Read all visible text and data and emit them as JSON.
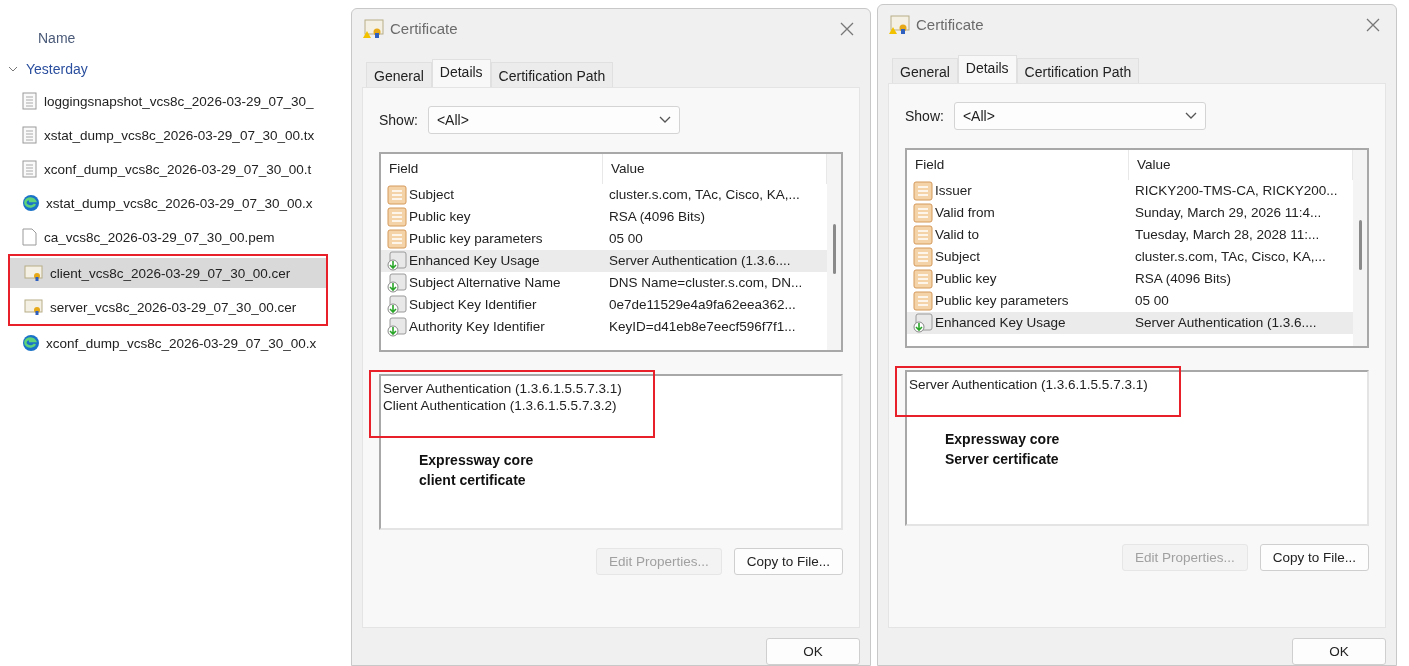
{
  "explorer": {
    "column_header": "Name",
    "group": {
      "label": "Yesterday",
      "expanded": true
    },
    "files": [
      {
        "name": "loggingsnapshot_vcs8c_2026-03-29_07_30_",
        "kind": "text",
        "selected": false,
        "highlighted": false
      },
      {
        "name": "xstat_dump_vcs8c_2026-03-29_07_30_00.tx",
        "kind": "text",
        "selected": false,
        "highlighted": false
      },
      {
        "name": "xconf_dump_vcs8c_2026-03-29_07_30_00.t",
        "kind": "text",
        "selected": false,
        "highlighted": false
      },
      {
        "name": "xstat_dump_vcs8c_2026-03-29_07_30_00.x",
        "kind": "web",
        "selected": false,
        "highlighted": false
      },
      {
        "name": "ca_vcs8c_2026-03-29_07_30_00.pem",
        "kind": "blank",
        "selected": false,
        "highlighted": false
      },
      {
        "name": "client_vcs8c_2026-03-29_07_30_00.cer",
        "kind": "cert",
        "selected": true,
        "highlighted": true
      },
      {
        "name": "server_vcs8c_2026-03-29_07_30_00.cer",
        "kind": "cert",
        "selected": false,
        "highlighted": true
      },
      {
        "name": "xconf_dump_vcs8c_2026-03-29_07_30_00.x",
        "kind": "web",
        "selected": false,
        "highlighted": false
      }
    ]
  },
  "dialogs": [
    {
      "title": "Certificate",
      "tabs": [
        {
          "label": "General",
          "selected": false
        },
        {
          "label": "Details",
          "selected": true
        },
        {
          "label": "Certification Path",
          "selected": false
        }
      ],
      "show_label": "Show:",
      "show_value": "<All>",
      "columns": [
        "Field",
        "Value"
      ],
      "fields": [
        {
          "field": "Subject",
          "value": "cluster.s.com, TAc, Cisco, KA,...",
          "kind": "property",
          "selected": false
        },
        {
          "field": "Public key",
          "value": "RSA (4096 Bits)",
          "kind": "property",
          "selected": false
        },
        {
          "field": "Public key parameters",
          "value": "05 00",
          "kind": "property",
          "selected": false
        },
        {
          "field": "Enhanced Key Usage",
          "value": "Server Authentication (1.3.6....",
          "kind": "extension",
          "selected": true
        },
        {
          "field": "Subject Alternative Name",
          "value": "DNS Name=cluster.s.com, DN...",
          "kind": "extension",
          "selected": false
        },
        {
          "field": "Subject Key Identifier",
          "value": "0e7de11529e4a9fa62eea362...",
          "kind": "extension",
          "selected": false
        },
        {
          "field": "Authority Key Identifier",
          "value": "KeyID=d41eb8e7eecf596f7f1...",
          "kind": "extension",
          "selected": false
        }
      ],
      "details": {
        "lines": [
          "Server Authentication (1.3.6.1.5.5.7.3.1)",
          "Client Authentication (1.3.6.1.5.5.7.3.2)"
        ],
        "highlighted": true
      },
      "note": [
        "Expressway core",
        "client certificate"
      ],
      "buttons": [
        {
          "label": "Edit Properties...",
          "disabled": true
        },
        {
          "label": "Copy to File...",
          "disabled": false
        }
      ],
      "ok": "OK"
    },
    {
      "title": "Certificate",
      "tabs": [
        {
          "label": "General",
          "selected": false
        },
        {
          "label": "Details",
          "selected": true
        },
        {
          "label": "Certification Path",
          "selected": false
        }
      ],
      "show_label": "Show:",
      "show_value": "<All>",
      "columns": [
        "Field",
        "Value"
      ],
      "fields": [
        {
          "field": "Issuer",
          "value": "RICKY200-TMS-CA, RICKY200...",
          "kind": "property",
          "selected": false
        },
        {
          "field": "Valid from",
          "value": "Sunday, March 29, 2026 11:4...",
          "kind": "property",
          "selected": false
        },
        {
          "field": "Valid to",
          "value": "Tuesday, March 28, 2028 11:...",
          "kind": "property",
          "selected": false
        },
        {
          "field": "Subject",
          "value": "cluster.s.com, TAc, Cisco, KA,...",
          "kind": "property",
          "selected": false
        },
        {
          "field": "Public key",
          "value": "RSA (4096 Bits)",
          "kind": "property",
          "selected": false
        },
        {
          "field": "Public key parameters",
          "value": "05 00",
          "kind": "property",
          "selected": false
        },
        {
          "field": "Enhanced Key Usage",
          "value": "Server Authentication (1.3.6....",
          "kind": "extension",
          "selected": true
        }
      ],
      "details": {
        "lines": [
          "Server Authentication (1.3.6.1.5.5.7.3.1)"
        ],
        "highlighted": true
      },
      "note": [
        "Expressway core",
        "Server certificate"
      ],
      "buttons": [
        {
          "label": "Edit Properties...",
          "disabled": true
        },
        {
          "label": "Copy to File...",
          "disabled": false
        }
      ],
      "ok": "OK"
    }
  ]
}
